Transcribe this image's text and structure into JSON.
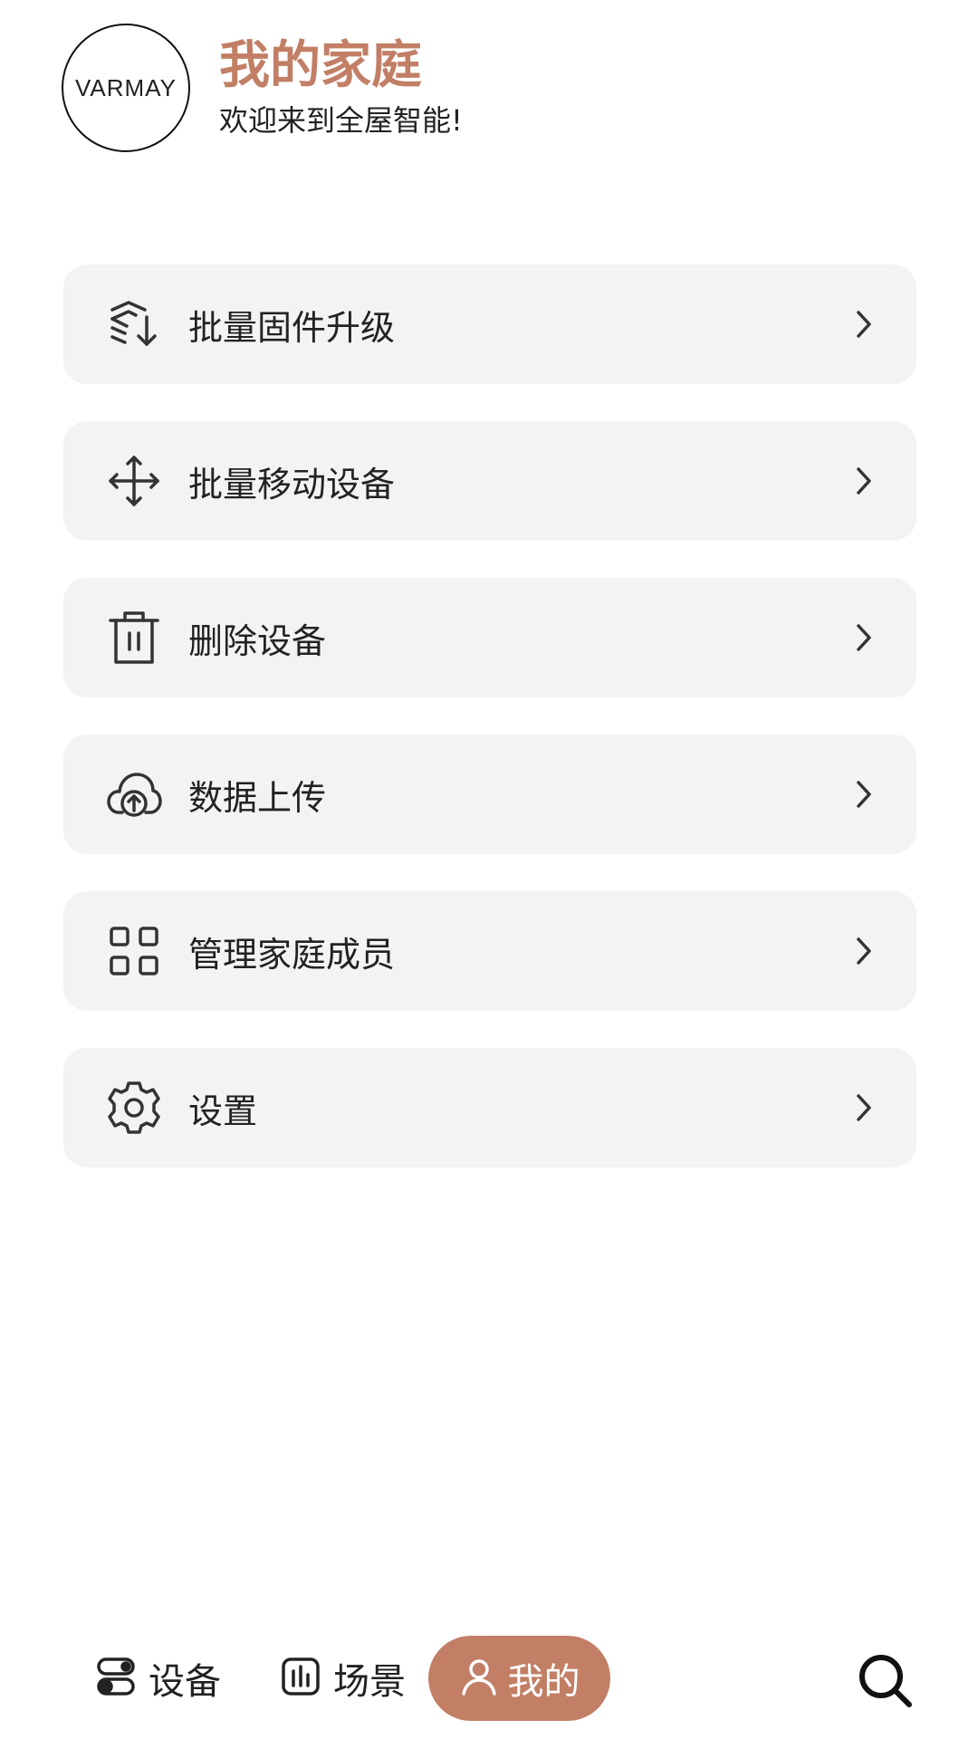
{
  "header": {
    "logo_text": "VARMAY",
    "title": "我的家庭",
    "subtitle": "欢迎来到全屋智能!"
  },
  "menu": {
    "items": [
      {
        "label": "批量固件升级",
        "icon": "firmware-upgrade-icon"
      },
      {
        "label": "批量移动设备",
        "icon": "move-arrows-icon"
      },
      {
        "label": "删除设备",
        "icon": "trash-icon"
      },
      {
        "label": "数据上传",
        "icon": "cloud-upload-icon"
      },
      {
        "label": "管理家庭成员",
        "icon": "grid-icon"
      },
      {
        "label": "设置",
        "icon": "gear-icon"
      }
    ]
  },
  "bottom_nav": {
    "devices_label": "设备",
    "scenes_label": "场景",
    "mine_label": "我的",
    "active": "mine",
    "search_icon": "search-icon"
  },
  "colors": {
    "accent": "#c27f66",
    "card_bg": "#f3f3f3",
    "text": "#222222"
  }
}
